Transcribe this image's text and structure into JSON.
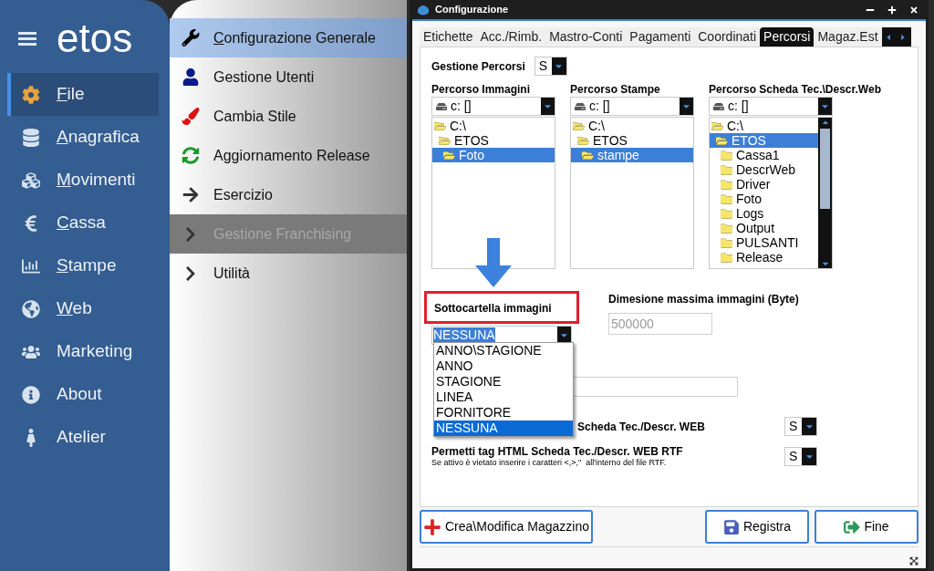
{
  "sidebar": {
    "logo": "etos",
    "items": [
      {
        "label": "File",
        "selected": true,
        "hotkey": true
      },
      {
        "label": "Anagrafica",
        "selected": false,
        "hotkey": true
      },
      {
        "label": "Movimenti",
        "selected": false,
        "hotkey": true
      },
      {
        "label": "Cassa",
        "selected": false,
        "hotkey": true
      },
      {
        "label": "Stampe",
        "selected": false,
        "hotkey": true
      },
      {
        "label": "Web",
        "selected": false,
        "hotkey": true
      },
      {
        "label": "Marketing",
        "selected": false,
        "hotkey": false
      },
      {
        "label": "About",
        "selected": false,
        "hotkey": false
      },
      {
        "label": "Atelier",
        "selected": false,
        "hotkey": false
      }
    ]
  },
  "menu": {
    "items": [
      {
        "label": "Configurazione Generale",
        "selected": true,
        "disabled": false,
        "hotkey": true
      },
      {
        "label": "Gestione Utenti",
        "selected": false,
        "disabled": false,
        "hotkey": false
      },
      {
        "label": "Cambia Stile",
        "selected": false,
        "disabled": false,
        "hotkey": false
      },
      {
        "label": "Aggiornamento Release",
        "selected": false,
        "disabled": false,
        "hotkey": false
      },
      {
        "label": "Esercizio",
        "selected": false,
        "disabled": false,
        "hotkey": false
      },
      {
        "label": "Gestione Franchising",
        "selected": false,
        "disabled": true,
        "hotkey": false
      },
      {
        "label": "Utilità",
        "selected": false,
        "disabled": false,
        "hotkey": false
      }
    ]
  },
  "dialog": {
    "title": "Configurazione",
    "tabs": [
      {
        "label": "Etichette",
        "selected": false
      },
      {
        "label": "Acc./Rimb.",
        "selected": false
      },
      {
        "label": "Mastro-Conti",
        "selected": false
      },
      {
        "label": "Pagamenti",
        "selected": false
      },
      {
        "label": "Coordinati",
        "selected": false
      },
      {
        "label": "Percorsi",
        "selected": true
      },
      {
        "label": "Magaz.Est",
        "selected": false
      }
    ],
    "gestione_percorsi": {
      "label": "Gestione Percorsi",
      "value": "S"
    },
    "paths": [
      {
        "label": "Percorso Immagini",
        "drive": "c: []",
        "scrollbar": false,
        "tree": [
          {
            "label": "C:\\",
            "expanded": true,
            "selected": false,
            "children": [
              {
                "label": "ETOS",
                "expanded": true,
                "selected": false,
                "children": [
                  {
                    "label": "Foto",
                    "expanded": true,
                    "selected": true
                  }
                ]
              }
            ]
          }
        ]
      },
      {
        "label": "Percorso Stampe",
        "drive": "c: []",
        "scrollbar": false,
        "tree": [
          {
            "label": "C:\\",
            "expanded": true,
            "selected": false,
            "children": [
              {
                "label": "ETOS",
                "expanded": true,
                "selected": false,
                "children": [
                  {
                    "label": "stampe",
                    "expanded": true,
                    "selected": true
                  }
                ]
              }
            ]
          }
        ]
      },
      {
        "label": "Percorso Scheda Tec.\\Descr.Web",
        "drive": "c: []",
        "scrollbar": true,
        "tree": [
          {
            "label": "C:\\",
            "expanded": true,
            "selected": false,
            "children": [
              {
                "label": "ETOS",
                "expanded": true,
                "selected": true,
                "children": [
                  {
                    "label": "Cassa1",
                    "expanded": false,
                    "selected": false
                  },
                  {
                    "label": "DescrWeb",
                    "expanded": false,
                    "selected": false
                  },
                  {
                    "label": "Driver",
                    "expanded": false,
                    "selected": false
                  },
                  {
                    "label": "Foto",
                    "expanded": false,
                    "selected": false
                  },
                  {
                    "label": "Logs",
                    "expanded": false,
                    "selected": false
                  },
                  {
                    "label": "Output",
                    "expanded": false,
                    "selected": false
                  },
                  {
                    "label": "PULSANTI",
                    "expanded": false,
                    "selected": false
                  },
                  {
                    "label": "Release",
                    "expanded": false,
                    "selected": false
                  }
                ]
              }
            ]
          }
        ]
      }
    ],
    "subfolder": {
      "label": "Sottocartella immagini",
      "value": "NESSUNA",
      "highlighted": true,
      "options": [
        {
          "label": "ANNO\\STAGIONE",
          "selected": false
        },
        {
          "label": "ANNO",
          "selected": false
        },
        {
          "label": "STAGIONE",
          "selected": false
        },
        {
          "label": "LINEA",
          "selected": false
        },
        {
          "label": "FORNITORE",
          "selected": false
        },
        {
          "label": "NESSUNA",
          "selected": true
        }
      ]
    },
    "max_size": {
      "label": "Dimesione massima immagini (Byte)",
      "value": "500000",
      "disabled": true
    },
    "stili": {
      "label": "Scheda Tec./Descr. WEB",
      "value": "S"
    },
    "permetti": {
      "label": "Permetti tag HTML Scheda Tec./Descr. WEB RTF",
      "note": "Se attivo è vietato inserire i caratteri <,>,\"  all'interno del file RTF.",
      "value": "S"
    },
    "buttons": [
      {
        "label": "Crea\\Modifica Magazzino"
      },
      {
        "label": "Registra"
      },
      {
        "label": "Fine"
      }
    ]
  }
}
